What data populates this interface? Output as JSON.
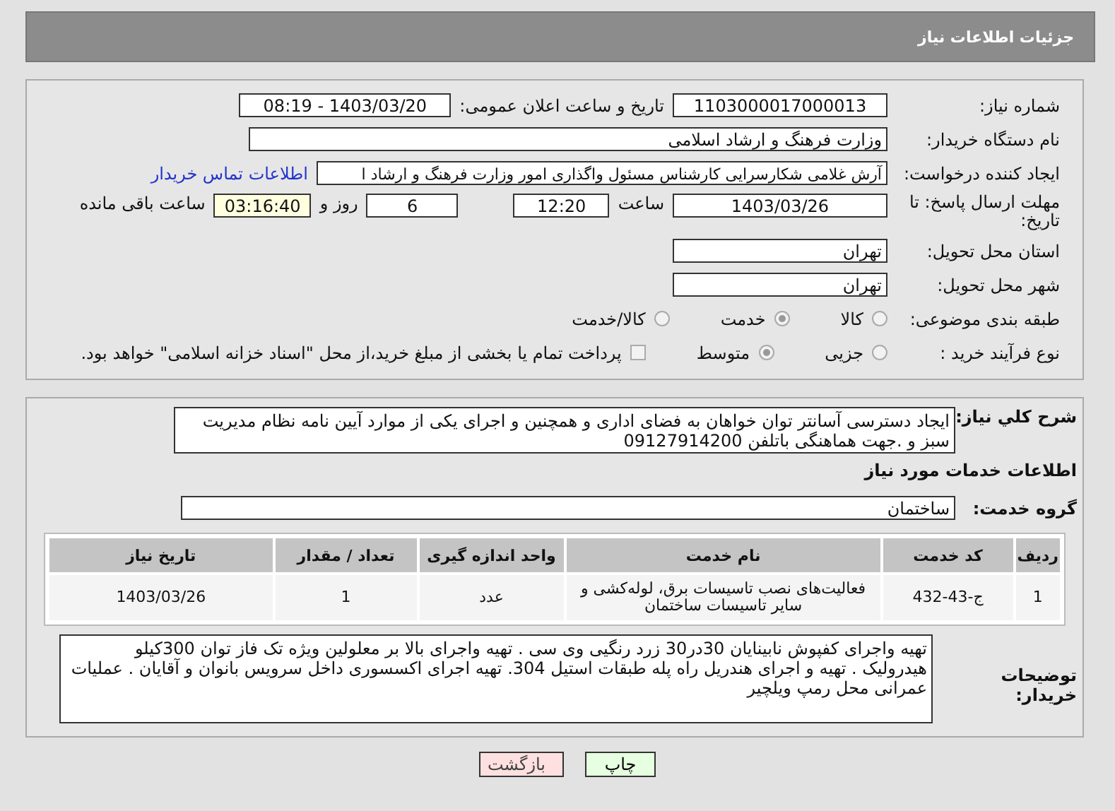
{
  "header": {
    "title": "جزئیات اطلاعات نیاز"
  },
  "details": {
    "need_number": {
      "label": "شماره نیاز:",
      "value": "1103000017000013"
    },
    "announce": {
      "label": "تاریخ و ساعت اعلان عمومی:",
      "value": "1403/03/20 - 08:19"
    },
    "buyer": {
      "label": "نام دستگاه خریدار:",
      "value": "وزارت فرهنگ و ارشاد اسلامی"
    },
    "creator": {
      "label": "ایجاد کننده درخواست:",
      "value": "آرش غلامی شکارسرایی کارشناس مسئول واگذاری امور وزارت فرهنگ و ارشاد ا",
      "link": "اطلاعات تماس خریدار"
    },
    "deadline": {
      "label": "مهلت ارسال پاسخ: تا تاریخ:",
      "date": "1403/03/26",
      "time_label": "ساعت",
      "time": "12:20",
      "days": "6",
      "days_label": "روز و",
      "remaining": "03:16:40",
      "remaining_label": "ساعت باقی مانده"
    },
    "province": {
      "label": "استان محل تحویل:",
      "value": "تهران"
    },
    "city": {
      "label": "شهر محل تحویل:",
      "value": "تهران"
    },
    "category": {
      "label": "طبقه بندی موضوعی:",
      "options": [
        {
          "label": "کالا",
          "selected": false
        },
        {
          "label": "خدمت",
          "selected": true
        },
        {
          "label": "کالا/خدمت",
          "selected": false
        }
      ]
    },
    "process": {
      "label": "نوع فرآیند خرید :",
      "options": [
        {
          "label": "جزیی",
          "selected": false
        },
        {
          "label": "متوسط",
          "selected": true
        }
      ],
      "payment": {
        "label": "پرداخت تمام یا بخشی از مبلغ خرید،از محل \"اسناد خزانه اسلامی\" خواهد بود.",
        "checked": false
      }
    }
  },
  "needs": {
    "description": {
      "label": "شرح کلي نياز:",
      "value": "ایجاد دسترسی آسانتر توان خواهان به فضای اداری و همچنین و اجرای یکی از موارد آیین نامه نظام مدیریت سبز و .جهت هماهنگی  باتلفن 09127914200"
    },
    "section_title": "اطلاعات خدمات مورد نیاز",
    "service_group": {
      "label": "گروه خدمت:",
      "value": "ساختمان"
    },
    "table": {
      "columns": [
        "ردیف",
        "کد خدمت",
        "نام خدمت",
        "واحد اندازه گیری",
        "تعداد / مقدار",
        "تاریخ نیاز"
      ],
      "rows": [
        [
          "1",
          "ج-43-432",
          "فعالیت‌های نصب تاسیسات برق، لوله‌کشی و سایر تاسیسات ساختمان",
          "عدد",
          "1",
          "1403/03/26"
        ]
      ]
    },
    "buyer_notes": {
      "label": "توضیحات خریدار:",
      "value": "تهیه واجرای کفپوش نابینایان 30در30 زرد رنگیی وی سی . تهیه واجرای بالا بر معلولین ویژه تک فاز توان 300کیلو هیدرولیک . تهیه و اجرای هندریل راه پله طبقات استیل 304. تهیه اجرای اکسسوری داخل سرویس بانوان و آقایان . عملیات عمرانی محل رمپ ویلچیر"
    }
  },
  "buttons": [
    {
      "label": "چاپ",
      "kind": "print"
    },
    {
      "label": "بازگشت",
      "kind": "back"
    }
  ]
}
